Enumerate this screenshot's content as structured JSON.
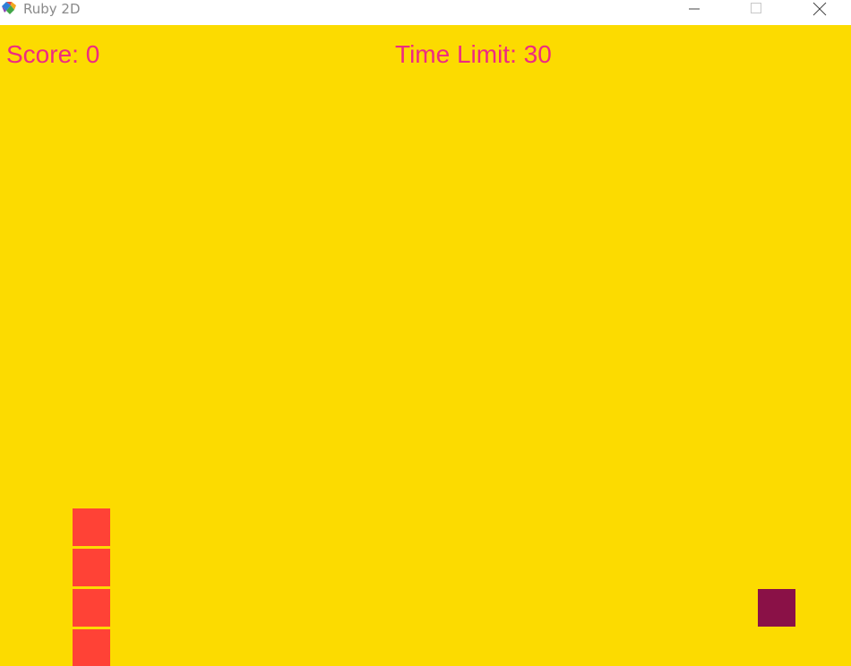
{
  "window": {
    "title": "Ruby 2D"
  },
  "hud": {
    "score": "Score: 0",
    "time_limit": "Time Limit: 30"
  },
  "colors": {
    "background": "#fcdb00",
    "text": "#ee2a82",
    "snake": "#ff4236",
    "food": "#8a1147"
  },
  "game": {
    "snake_segments": 4,
    "food_count": 1
  }
}
